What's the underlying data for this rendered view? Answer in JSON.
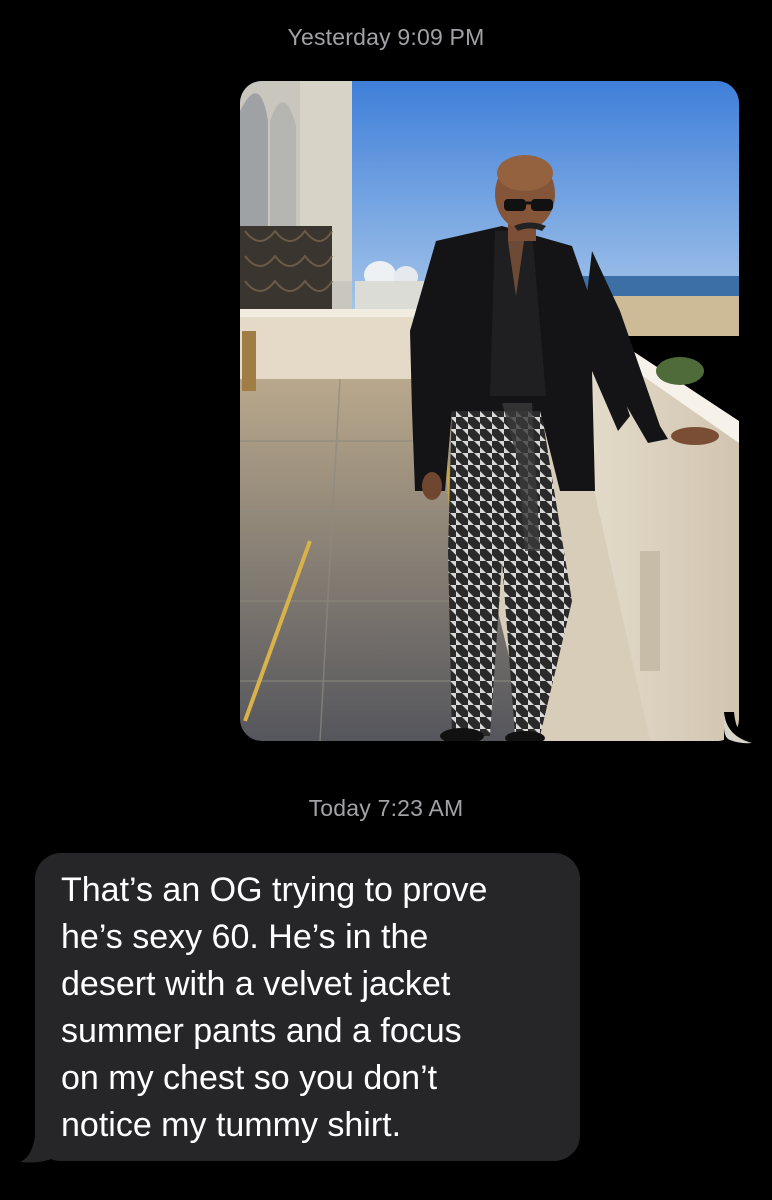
{
  "thread": {
    "timestamp_yesterday": "Yesterday 9:09 PM",
    "timestamp_today": "Today 7:23 AM"
  },
  "messages": [
    {
      "direction": "outgoing",
      "type": "photo",
      "photo_subject": "man in black velvet jacket and patterned pants on a terrace"
    },
    {
      "direction": "incoming",
      "type": "text",
      "text": "That’s an OG trying to prove\nhe’s sexy 60. He’s in the\ndesert with a velvet jacket\nsummer pants and a focus\non my chest so you don’t\nnotice my tummy shirt."
    }
  ],
  "colors": {
    "background": "#000000",
    "timestamp": "#a1a1a6",
    "incoming_bubble": "#262628",
    "message_text": "#ffffff"
  }
}
